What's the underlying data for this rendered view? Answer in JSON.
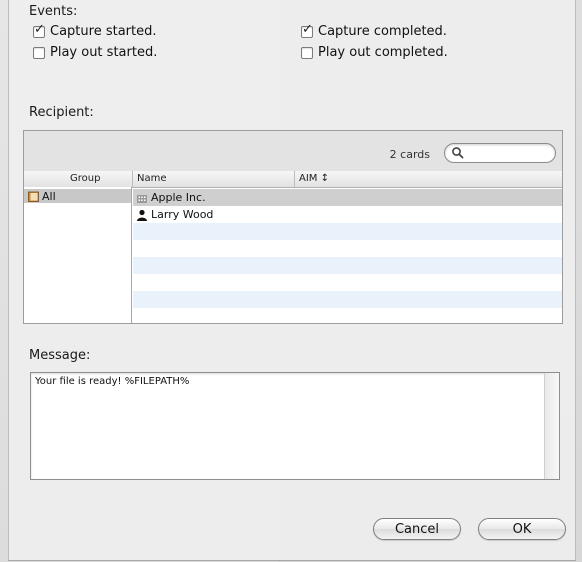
{
  "events": {
    "label": "Events:",
    "items": [
      {
        "label": "Capture started.",
        "checked": true
      },
      {
        "label": "Capture completed.",
        "checked": true
      },
      {
        "label": "Play out started.",
        "checked": false
      },
      {
        "label": "Play out completed.",
        "checked": false
      }
    ]
  },
  "recipient": {
    "label": "Recipient:",
    "cards_count": "2 cards",
    "search": {
      "placeholder": "",
      "value": ""
    },
    "columns": {
      "group": "Group",
      "name": "Name",
      "aim": "AIM ↕"
    },
    "groups": [
      {
        "label": "All",
        "icon": "folder-icon"
      }
    ],
    "cards": [
      {
        "name": "Apple Inc.",
        "icon": "company-icon"
      },
      {
        "name": "Larry Wood",
        "icon": "person-icon"
      }
    ]
  },
  "message": {
    "label": "Message:",
    "text": "Your file is ready! %FILEPATH%"
  },
  "buttons": {
    "cancel": "Cancel",
    "ok": "OK"
  }
}
